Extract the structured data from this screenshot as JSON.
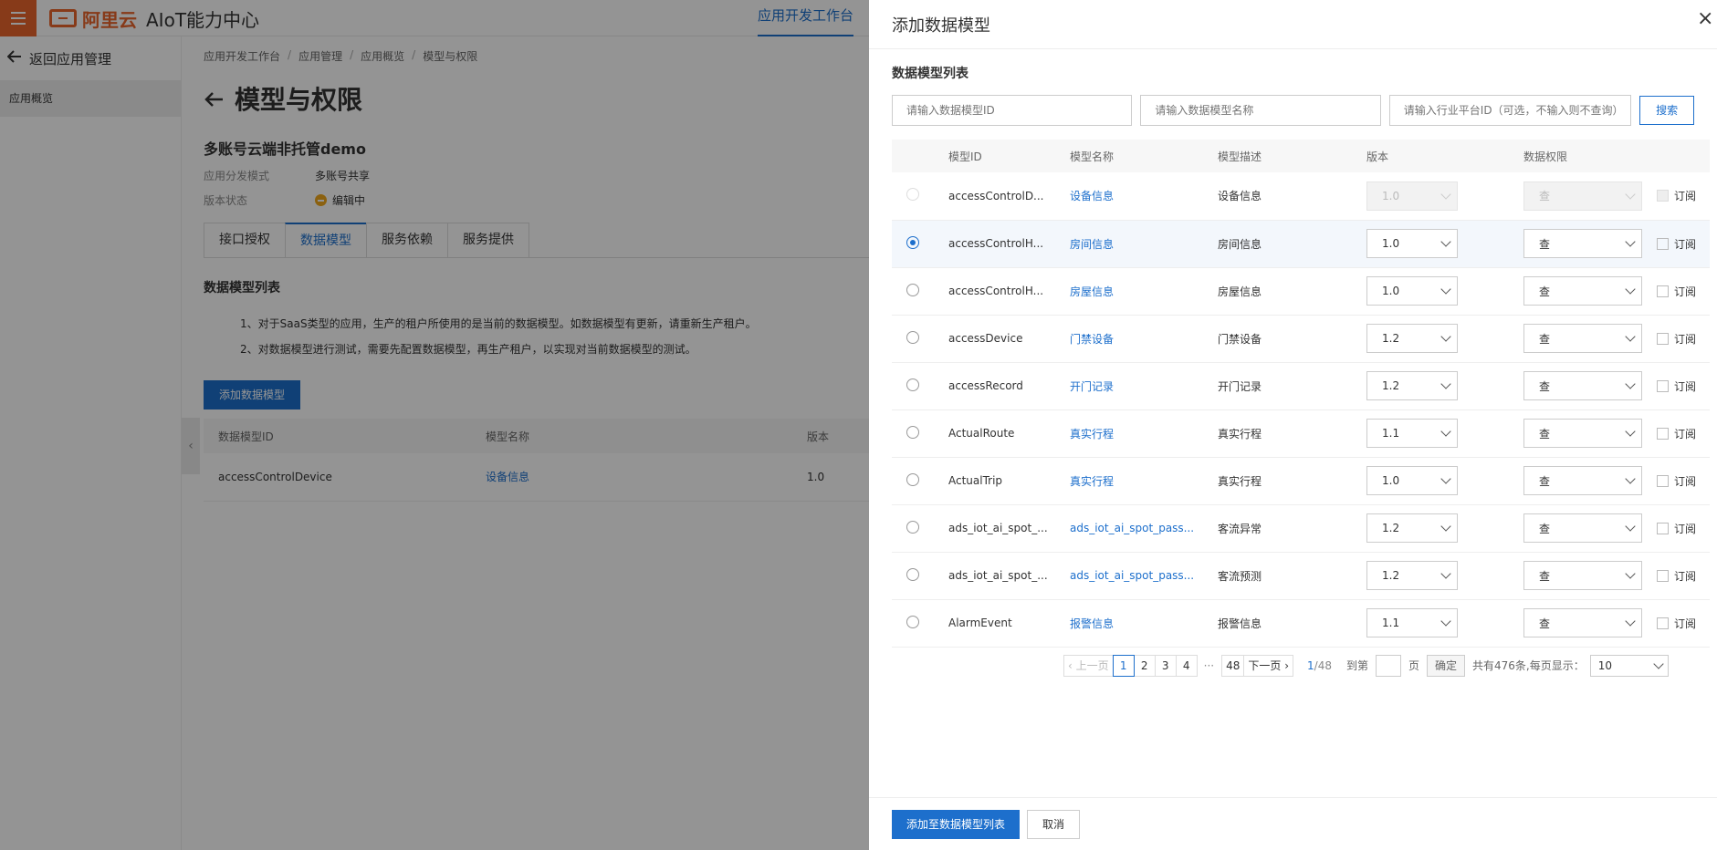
{
  "topbar": {
    "logo_brand": "阿里云",
    "logo_title": "AIoT能力中心",
    "nav_active": "应用开发工作台"
  },
  "sidebar": {
    "back_label": "返回应用管理",
    "items": [
      {
        "label": "应用概览"
      }
    ]
  },
  "main": {
    "breadcrumb": [
      "应用开发工作台",
      "应用管理",
      "应用概览",
      "模型与权限"
    ],
    "page_title": "模型与权限",
    "app_name": "多账号云端非托管demo",
    "meta": [
      {
        "key": "应用分发模式",
        "value": "多账号共享"
      },
      {
        "key": "版本状态",
        "value": "编辑中"
      }
    ],
    "tabs": [
      "接口授权",
      "数据模型",
      "服务依赖",
      "服务提供"
    ],
    "active_tab": "数据模型",
    "section_title": "数据模型列表",
    "notices": [
      "1、对于SaaS类型的应用，生产的租户所使用的是当前的数据模型。如数据模型有更新，请重新生产租户。",
      "2、对数据模型进行测试，需要先配置数据模型，再生产租户，以实现对当前数据模型的测试。"
    ],
    "add_button": "添加数据模型",
    "table": {
      "headers": [
        "数据模型ID",
        "模型名称",
        "版本"
      ],
      "rows": [
        {
          "id": "accessControlDevice",
          "name": "设备信息",
          "version": "1.0"
        }
      ]
    }
  },
  "drawer": {
    "title": "添加数据模型",
    "close_icon": "×",
    "list_title": "数据模型列表",
    "search": {
      "id_placeholder": "请输入数据模型ID",
      "name_placeholder": "请输入数据模型名称",
      "platform_placeholder": "请输入行业平台ID（可选，不输入则不查询）",
      "button": "搜索"
    },
    "table": {
      "headers": [
        "模型ID",
        "模型名称",
        "模型描述",
        "版本",
        "数据权限"
      ],
      "subscribe_label": "订阅",
      "rows": [
        {
          "id": "accessControlD...",
          "name": "设备信息",
          "desc": "设备信息",
          "version": "1.0",
          "perm": "查",
          "selected": false,
          "disabled": true
        },
        {
          "id": "accessControlH...",
          "name": "房间信息",
          "desc": "房间信息",
          "version": "1.0",
          "perm": "查",
          "selected": true,
          "disabled": false
        },
        {
          "id": "accessControlH...",
          "name": "房屋信息",
          "desc": "房屋信息",
          "version": "1.0",
          "perm": "查",
          "selected": false,
          "disabled": false
        },
        {
          "id": "accessDevice",
          "name": "门禁设备",
          "desc": "门禁设备",
          "version": "1.2",
          "perm": "查",
          "selected": false,
          "disabled": false
        },
        {
          "id": "accessRecord",
          "name": "开门记录",
          "desc": "开门记录",
          "version": "1.2",
          "perm": "查",
          "selected": false,
          "disabled": false
        },
        {
          "id": "ActualRoute",
          "name": "真实行程",
          "desc": "真实行程",
          "version": "1.1",
          "perm": "查",
          "selected": false,
          "disabled": false
        },
        {
          "id": "ActualTrip",
          "name": "真实行程",
          "desc": "真实行程",
          "version": "1.0",
          "perm": "查",
          "selected": false,
          "disabled": false
        },
        {
          "id": "ads_iot_ai_spot_...",
          "name": "ads_iot_ai_spot_pass...",
          "desc": "客流异常",
          "version": "1.2",
          "perm": "查",
          "selected": false,
          "disabled": false
        },
        {
          "id": "ads_iot_ai_spot_...",
          "name": "ads_iot_ai_spot_pass...",
          "desc": "客流预测",
          "version": "1.2",
          "perm": "查",
          "selected": false,
          "disabled": false
        },
        {
          "id": "AlarmEvent",
          "name": "报警信息",
          "desc": "报警信息",
          "version": "1.1",
          "perm": "查",
          "selected": false,
          "disabled": false
        }
      ]
    },
    "pager": {
      "prev": "上一页",
      "pages": [
        "1",
        "2",
        "3",
        "4"
      ],
      "ellipsis": "···",
      "last": "48",
      "next": "下一页",
      "current": "1",
      "total_pages": "/48",
      "goto_label": "到第",
      "page_unit": "页",
      "confirm": "确定",
      "total_text": "共有476条,每页显示：",
      "page_size": "10"
    },
    "footer": {
      "submit": "添加至数据模型列表",
      "cancel": "取消"
    }
  },
  "colors": {
    "accent": "#1d6fcc",
    "brand": "#e8652c",
    "status_editing": "#f0a81c"
  }
}
